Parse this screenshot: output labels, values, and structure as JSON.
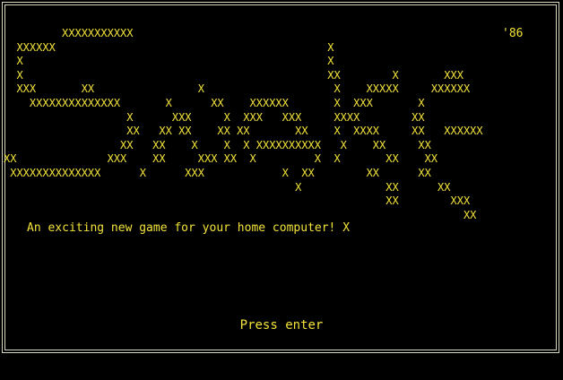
{
  "game": {
    "title_art": [
      "         XXXXXXXXXXX",
      "  XXXXXX                                          X",
      "  X                                               X",
      "  X                                               XX        X       XXX",
      "  XXX       XX                X                    X    XXXXX     XXXXXX",
      "    XXXXXXXXXXXXXX       X      XX    XXXXXX       X  XXX       X",
      "                   X      XXX     X  XXX   XXX     XXXX        XX",
      "                   XX   XX XX    XX XX       XX    X  XXXX     XX   XXXXXX",
      "                  XX   XX    X    X  X XXXXXXXXXX   X    XX     XX",
      "XX              XXX    XX     XXX XX  X         X  X       XX    XX",
      " XXXXXXXXXXXXXX      X      XXX            X  XX        XX      XX",
      "                                             X             XX      XX",
      "                                                           XX        XXX",
      "                                                                       XX"
    ],
    "year": "'86",
    "tagline": "An exciting new game for your home computer! X",
    "prompt": "Press enter"
  },
  "colors": {
    "background": "#000000",
    "text": "#f2e23a",
    "border": "#d8d8c0"
  }
}
